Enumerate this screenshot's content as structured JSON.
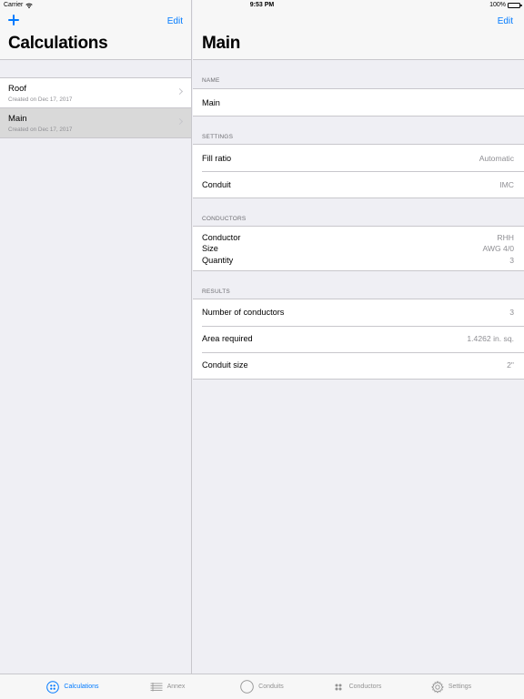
{
  "status_bar": {
    "carrier": "Carrier",
    "time": "9:53 PM",
    "battery": "100%",
    "battery_level": 1.0
  },
  "master": {
    "title": "Calculations",
    "edit_label": "Edit",
    "add_icon": "plus-icon",
    "items": [
      {
        "name": "Roof",
        "date": "Created on Dec 17, 2017",
        "selected": false
      },
      {
        "name": "Main",
        "date": "Created on Dec 17, 2017",
        "selected": true
      }
    ]
  },
  "detail": {
    "title": "Main",
    "edit_label": "Edit",
    "sections": {
      "name": {
        "header": "NAME",
        "value": "Main"
      },
      "settings": {
        "header": "SETTINGS",
        "rows": [
          {
            "label": "Fill ratio",
            "value": "Automatic"
          },
          {
            "label": "Conduit",
            "value": "IMC"
          }
        ]
      },
      "conductors": {
        "header": "CONDUCTORS",
        "lines": [
          {
            "label": "Conductor",
            "value": "RHH"
          },
          {
            "label": "Size",
            "value": "AWG 4/0"
          },
          {
            "label": "Quantity",
            "value": "3"
          }
        ]
      },
      "results": {
        "header": "RESULTS",
        "rows": [
          {
            "label": "Number of conductors",
            "value": "3"
          },
          {
            "label": "Area required",
            "value": "1.4262 in. sq."
          },
          {
            "label": "Conduit size",
            "value": "2\""
          }
        ]
      }
    }
  },
  "tab_bar": {
    "active_color": "#007aff",
    "inactive_color": "#929292",
    "tabs": [
      {
        "label": "Calculations",
        "icon": "calculations-icon",
        "active": true
      },
      {
        "label": "Annex",
        "icon": "annex-list-icon",
        "active": false
      },
      {
        "label": "Conduits",
        "icon": "conduit-circle-icon",
        "active": false
      },
      {
        "label": "Conductors",
        "icon": "conductors-dots-icon",
        "active": false
      },
      {
        "label": "Settings",
        "icon": "gear-icon",
        "active": false
      }
    ]
  }
}
